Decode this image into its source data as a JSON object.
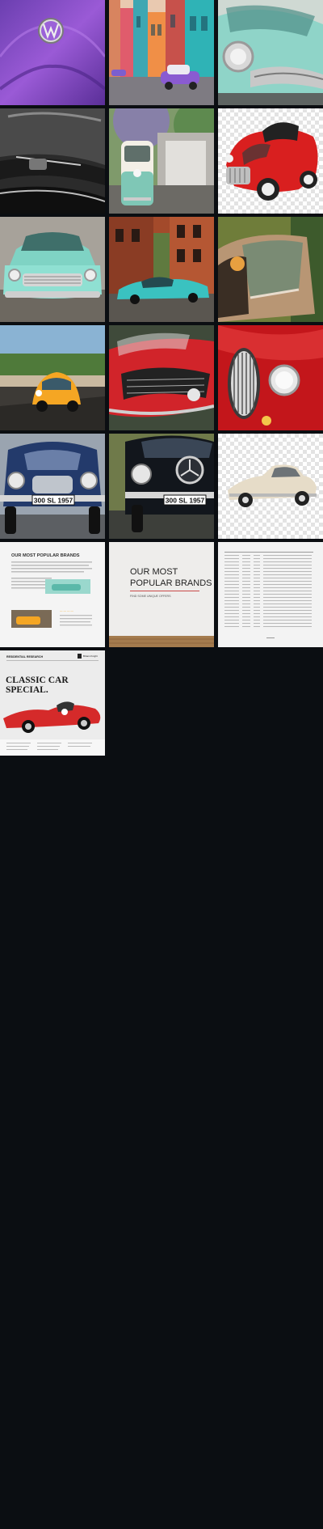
{
  "gallery": {
    "tiles": [
      {
        "subject": "VW emblem on purple body panel"
      },
      {
        "subject": "Classic car on colorful Havana street"
      },
      {
        "subject": "Turquoise classic car front"
      },
      {
        "subject": "Black classic car hood close-up"
      },
      {
        "subject": "VW bus under jacaranda tree"
      },
      {
        "subject": "Red convertible roadster"
      },
      {
        "subject": "Turquoise Chevrolet front"
      },
      {
        "subject": "Turquoise car in front of brick buildings"
      },
      {
        "subject": "Bronze classic car close-up"
      },
      {
        "subject": "Orange Fiat 500 on street"
      },
      {
        "subject": "Red Mustang front"
      },
      {
        "subject": "Red Jaguar grille close-up"
      },
      {
        "subject": "Blue Mercedes 300 SL front"
      },
      {
        "subject": "Black Mercedes 300 SL front"
      },
      {
        "subject": "Cream classic car cutout"
      },
      {
        "subject": "Document page: Our Most Popular Brands"
      },
      {
        "subject": "Slide: Our Most Popular Brands"
      },
      {
        "subject": "Spreadsheet document page"
      },
      {
        "subject": "Magazine cover: Classic Car Special"
      }
    ],
    "plate_text": "300 SL 1957",
    "brands_slide": {
      "title_line1": "OUR MOST",
      "title_line2": "POPULAR BRANDS",
      "subtitle": "FIND SOME UNIQUE OFFERS"
    },
    "brands_doc": {
      "heading": "OUR MOST POPULAR BRANDS"
    },
    "magazine": {
      "masthead": "RESIDENTIAL RESEARCH",
      "brand": "Britain Knight",
      "title_line1": "CLASSIC CAR",
      "title_line2": "SPECIAL."
    },
    "colors": {
      "background": "#0b0e12",
      "turquoise": "#7fd3c4",
      "red": "#d62020",
      "purple": "#8a4fc8"
    }
  }
}
